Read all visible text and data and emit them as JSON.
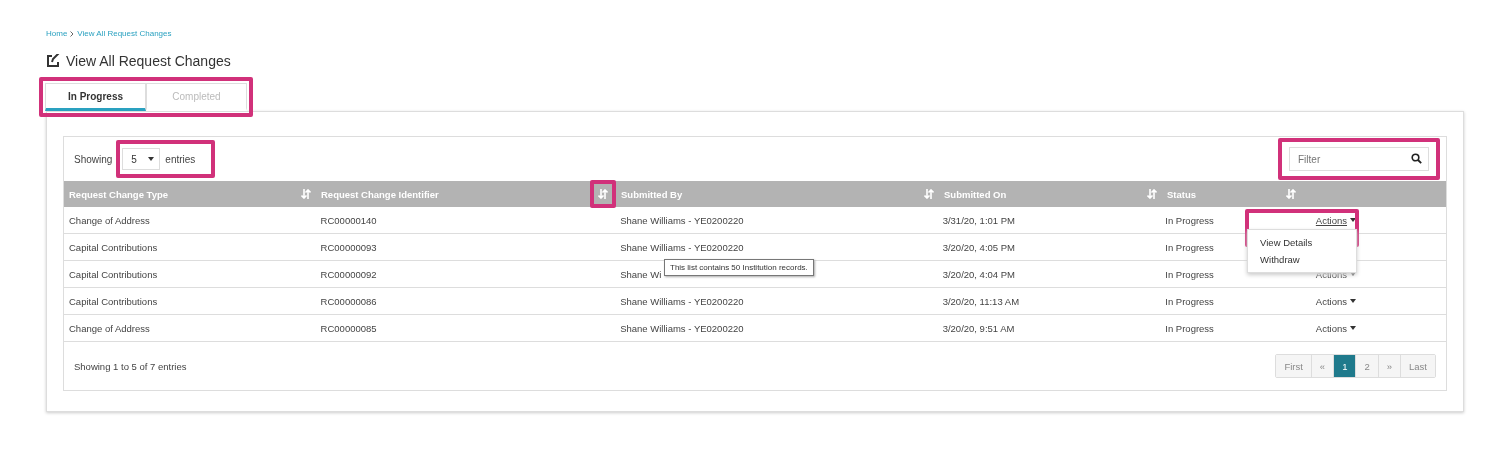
{
  "breadcrumb": [
    {
      "label": "Home"
    },
    {
      "label": "View All Request Changes"
    }
  ],
  "title": "View All Request Changes",
  "tabs": [
    {
      "label": "In Progress",
      "selected": true
    },
    {
      "label": "Completed",
      "selected": false
    }
  ],
  "length_control": {
    "before": "Showing",
    "value": "5",
    "after": "entries"
  },
  "filter": {
    "placeholder": "Filter"
  },
  "table": {
    "columns": [
      "Request Change Type",
      "Request Change Identifier",
      "Submitted By",
      "Submitted On",
      "Status"
    ],
    "rows": [
      {
        "cells": [
          "Change of Address",
          "RC00000140",
          "Shane Williams - YE0200220",
          "3/31/20, 1:01 PM",
          "In Progress"
        ],
        "action": "Actions",
        "menu_open": true
      },
      {
        "cells": [
          "Capital Contributions",
          "RC00000093",
          "Shane Williams - YE0200220",
          "3/20/20, 4:05 PM",
          "In Progress"
        ],
        "menu_open": false
      },
      {
        "cells": [
          "Capital Contributions",
          "RC00000092",
          "Shane Wi",
          "3/20/20, 4:04 PM",
          "In Progress"
        ],
        "action": "Actions",
        "menu_open": false
      },
      {
        "cells": [
          "Capital Contributions",
          "RC00000086",
          "Shane Williams - YE0200220",
          "3/20/20, 11:13 AM",
          "In Progress"
        ],
        "action": "Actions",
        "menu_open": false
      },
      {
        "cells": [
          "Change of Address",
          "RC00000085",
          "Shane Williams - YE0200220",
          "3/20/20, 9:51 AM",
          "In Progress"
        ],
        "action": "Actions",
        "menu_open": false
      }
    ]
  },
  "actions_menu": [
    "View Details",
    "Withdraw"
  ],
  "tooltip": "This list contains 50 Institution records.",
  "info": "Showing 1 to 5 of 7 entries",
  "pagination": [
    {
      "label": "First",
      "selected": false
    },
    {
      "label": "«",
      "selected": false
    },
    {
      "label": "1",
      "selected": true
    },
    {
      "label": "2",
      "selected": false
    },
    {
      "label": "»",
      "selected": false
    },
    {
      "label": "Last",
      "selected": false
    }
  ]
}
